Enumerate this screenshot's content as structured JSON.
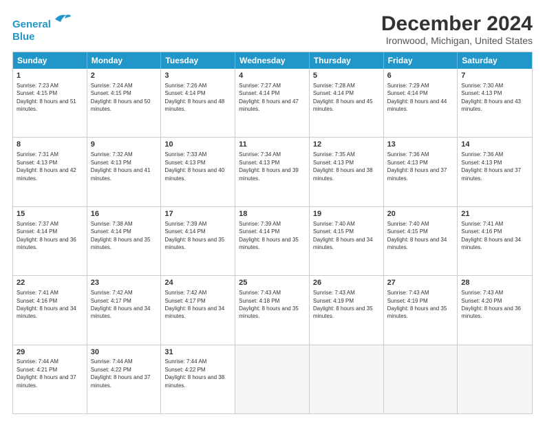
{
  "logo": {
    "line1": "General",
    "line2": "Blue"
  },
  "title": "December 2024",
  "subtitle": "Ironwood, Michigan, United States",
  "header_days": [
    "Sunday",
    "Monday",
    "Tuesday",
    "Wednesday",
    "Thursday",
    "Friday",
    "Saturday"
  ],
  "weeks": [
    [
      {
        "day": "1",
        "sunrise": "7:23 AM",
        "sunset": "4:15 PM",
        "daylight": "8 hours and 51 minutes."
      },
      {
        "day": "2",
        "sunrise": "7:24 AM",
        "sunset": "4:15 PM",
        "daylight": "8 hours and 50 minutes."
      },
      {
        "day": "3",
        "sunrise": "7:26 AM",
        "sunset": "4:14 PM",
        "daylight": "8 hours and 48 minutes."
      },
      {
        "day": "4",
        "sunrise": "7:27 AM",
        "sunset": "4:14 PM",
        "daylight": "8 hours and 47 minutes."
      },
      {
        "day": "5",
        "sunrise": "7:28 AM",
        "sunset": "4:14 PM",
        "daylight": "8 hours and 45 minutes."
      },
      {
        "day": "6",
        "sunrise": "7:29 AM",
        "sunset": "4:14 PM",
        "daylight": "8 hours and 44 minutes."
      },
      {
        "day": "7",
        "sunrise": "7:30 AM",
        "sunset": "4:13 PM",
        "daylight": "8 hours and 43 minutes."
      }
    ],
    [
      {
        "day": "8",
        "sunrise": "7:31 AM",
        "sunset": "4:13 PM",
        "daylight": "8 hours and 42 minutes."
      },
      {
        "day": "9",
        "sunrise": "7:32 AM",
        "sunset": "4:13 PM",
        "daylight": "8 hours and 41 minutes."
      },
      {
        "day": "10",
        "sunrise": "7:33 AM",
        "sunset": "4:13 PM",
        "daylight": "8 hours and 40 minutes."
      },
      {
        "day": "11",
        "sunrise": "7:34 AM",
        "sunset": "4:13 PM",
        "daylight": "8 hours and 39 minutes."
      },
      {
        "day": "12",
        "sunrise": "7:35 AM",
        "sunset": "4:13 PM",
        "daylight": "8 hours and 38 minutes."
      },
      {
        "day": "13",
        "sunrise": "7:36 AM",
        "sunset": "4:13 PM",
        "daylight": "8 hours and 37 minutes."
      },
      {
        "day": "14",
        "sunrise": "7:36 AM",
        "sunset": "4:13 PM",
        "daylight": "8 hours and 37 minutes."
      }
    ],
    [
      {
        "day": "15",
        "sunrise": "7:37 AM",
        "sunset": "4:14 PM",
        "daylight": "8 hours and 36 minutes."
      },
      {
        "day": "16",
        "sunrise": "7:38 AM",
        "sunset": "4:14 PM",
        "daylight": "8 hours and 35 minutes."
      },
      {
        "day": "17",
        "sunrise": "7:39 AM",
        "sunset": "4:14 PM",
        "daylight": "8 hours and 35 minutes."
      },
      {
        "day": "18",
        "sunrise": "7:39 AM",
        "sunset": "4:14 PM",
        "daylight": "8 hours and 35 minutes."
      },
      {
        "day": "19",
        "sunrise": "7:40 AM",
        "sunset": "4:15 PM",
        "daylight": "8 hours and 34 minutes."
      },
      {
        "day": "20",
        "sunrise": "7:40 AM",
        "sunset": "4:15 PM",
        "daylight": "8 hours and 34 minutes."
      },
      {
        "day": "21",
        "sunrise": "7:41 AM",
        "sunset": "4:16 PM",
        "daylight": "8 hours and 34 minutes."
      }
    ],
    [
      {
        "day": "22",
        "sunrise": "7:41 AM",
        "sunset": "4:16 PM",
        "daylight": "8 hours and 34 minutes."
      },
      {
        "day": "23",
        "sunrise": "7:42 AM",
        "sunset": "4:17 PM",
        "daylight": "8 hours and 34 minutes."
      },
      {
        "day": "24",
        "sunrise": "7:42 AM",
        "sunset": "4:17 PM",
        "daylight": "8 hours and 34 minutes."
      },
      {
        "day": "25",
        "sunrise": "7:43 AM",
        "sunset": "4:18 PM",
        "daylight": "8 hours and 35 minutes."
      },
      {
        "day": "26",
        "sunrise": "7:43 AM",
        "sunset": "4:19 PM",
        "daylight": "8 hours and 35 minutes."
      },
      {
        "day": "27",
        "sunrise": "7:43 AM",
        "sunset": "4:19 PM",
        "daylight": "8 hours and 35 minutes."
      },
      {
        "day": "28",
        "sunrise": "7:43 AM",
        "sunset": "4:20 PM",
        "daylight": "8 hours and 36 minutes."
      }
    ],
    [
      {
        "day": "29",
        "sunrise": "7:44 AM",
        "sunset": "4:21 PM",
        "daylight": "8 hours and 37 minutes."
      },
      {
        "day": "30",
        "sunrise": "7:44 AM",
        "sunset": "4:22 PM",
        "daylight": "8 hours and 37 minutes."
      },
      {
        "day": "31",
        "sunrise": "7:44 AM",
        "sunset": "4:22 PM",
        "daylight": "8 hours and 38 minutes."
      },
      null,
      null,
      null,
      null
    ]
  ],
  "labels": {
    "sunrise": "Sunrise:",
    "sunset": "Sunset:",
    "daylight": "Daylight:"
  }
}
